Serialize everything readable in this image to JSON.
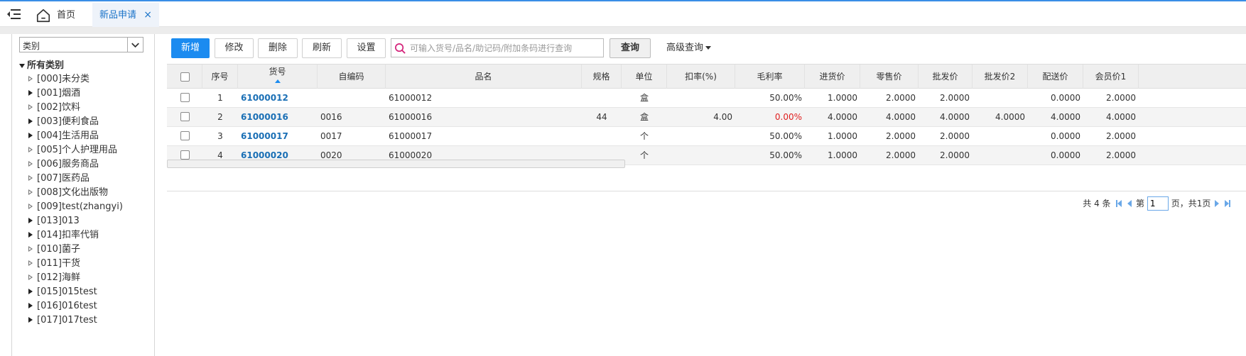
{
  "tabs": [
    {
      "label": "首页",
      "icon": "home-icon",
      "active": false
    },
    {
      "label": "新品申请",
      "active": true,
      "close": "×"
    }
  ],
  "sidebar": {
    "select_value": "类别",
    "root_label": "所有类别",
    "items": [
      {
        "label": "[000]未分类",
        "icon": "expand-arrow-outline"
      },
      {
        "label": "[001]烟酒",
        "icon": "expand-arrow-solid"
      },
      {
        "label": "[002]饮料",
        "icon": "expand-arrow-outline"
      },
      {
        "label": "[003]便利食品",
        "icon": "expand-arrow-solid"
      },
      {
        "label": "[004]生活用品",
        "icon": "expand-arrow-solid"
      },
      {
        "label": "[005]个人护理用品",
        "icon": "expand-arrow-outline"
      },
      {
        "label": "[006]服务商品",
        "icon": "expand-arrow-outline"
      },
      {
        "label": "[007]医药品",
        "icon": "expand-arrow-outline"
      },
      {
        "label": "[008]文化出版物",
        "icon": "expand-arrow-outline"
      },
      {
        "label": "[009]test(zhangyi)",
        "icon": "expand-arrow-outline"
      },
      {
        "label": "[013]013",
        "icon": "expand-arrow-solid"
      },
      {
        "label": "[014]扣率代销",
        "icon": "expand-arrow-solid"
      },
      {
        "label": "[010]菌子",
        "icon": "expand-arrow-outline"
      },
      {
        "label": "[011]干货",
        "icon": "expand-arrow-outline"
      },
      {
        "label": "[012]海鲜",
        "icon": "expand-arrow-outline"
      },
      {
        "label": "[015]015test",
        "icon": "expand-arrow-solid"
      },
      {
        "label": "[016]016test",
        "icon": "expand-arrow-solid"
      },
      {
        "label": "[017]017test",
        "icon": "expand-arrow-solid"
      }
    ]
  },
  "toolbar": {
    "add": "新增",
    "edit": "修改",
    "delete": "删除",
    "refresh": "刷新",
    "settings": "设置",
    "search_placeholder": "可输入货号/品名/助记码/附加条码进行查询",
    "search_button": "查询",
    "advanced": "高级查询"
  },
  "grid": {
    "columns": [
      "序号",
      "货号",
      "自编码",
      "品名",
      "规格",
      "单位",
      "扣率(%)",
      "毛利率",
      "进货价",
      "零售价",
      "批发价",
      "批发价2",
      "配送价",
      "会员价1"
    ],
    "rows": [
      {
        "no": "1",
        "sku": "61000012",
        "code": "",
        "name": "61000012",
        "spec": "",
        "unit": "盒",
        "discount": "",
        "margin": "50.00%",
        "margin_red": false,
        "cost": "1.0000",
        "retail": "2.0000",
        "wholesale": "2.0000",
        "wholesale2": "",
        "delivery": "0.0000",
        "member1": "2.0000"
      },
      {
        "no": "2",
        "sku": "61000016",
        "code": "0016",
        "name": "61000016",
        "spec": "44",
        "unit": "盒",
        "discount": "4.00",
        "margin": "0.00%",
        "margin_red": true,
        "cost": "4.0000",
        "retail": "4.0000",
        "wholesale": "4.0000",
        "wholesale2": "4.0000",
        "delivery": "4.0000",
        "member1": "4.0000"
      },
      {
        "no": "3",
        "sku": "61000017",
        "code": "0017",
        "name": "61000017",
        "spec": "",
        "unit": "个",
        "discount": "",
        "margin": "50.00%",
        "margin_red": false,
        "cost": "1.0000",
        "retail": "2.0000",
        "wholesale": "2.0000",
        "wholesale2": "",
        "delivery": "0.0000",
        "member1": "2.0000"
      },
      {
        "no": "4",
        "sku": "61000020",
        "code": "0020",
        "name": "61000020",
        "spec": "",
        "unit": "个",
        "discount": "",
        "margin": "50.00%",
        "margin_red": false,
        "cost": "1.0000",
        "retail": "2.0000",
        "wholesale": "2.0000",
        "wholesale2": "",
        "delivery": "0.0000",
        "member1": "2.0000"
      }
    ]
  },
  "pager": {
    "total": "共 4 条",
    "page_prefix": "第",
    "page_value": "1",
    "page_suffix": "页，共1页"
  },
  "colors": {
    "accent": "#1b8bf0",
    "sku_link": "#1a6fb5",
    "negative": "#e02020"
  }
}
